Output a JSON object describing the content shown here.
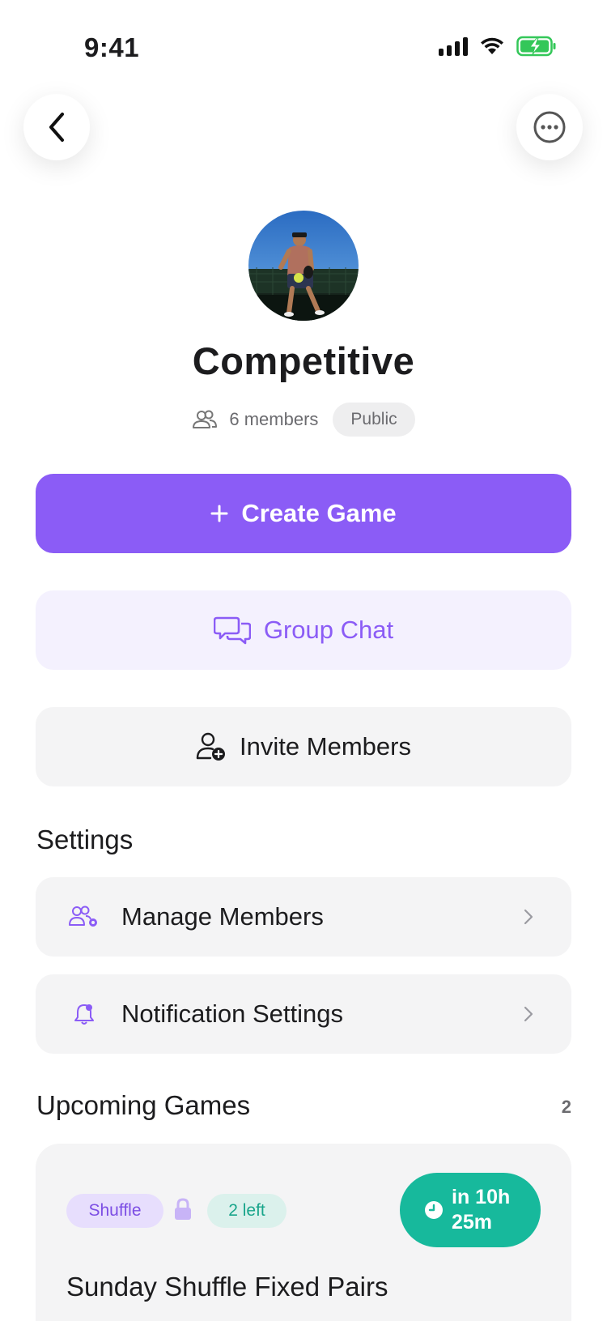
{
  "status_bar": {
    "time": "9:41"
  },
  "group": {
    "name": "Competitive",
    "members": "6 members",
    "visibility": "Public"
  },
  "actions": {
    "create_game": "Create Game",
    "group_chat": "Group Chat",
    "invite_members": "Invite Members"
  },
  "settings": {
    "title": "Settings",
    "items": [
      {
        "label": "Manage Members",
        "icon": "manage-members-icon"
      },
      {
        "label": "Notification Settings",
        "icon": "bell-icon"
      }
    ]
  },
  "upcoming": {
    "title": "Upcoming Games",
    "count": "2",
    "games": [
      {
        "type_tag": "Shuffle",
        "spots_tag": "2 left",
        "countdown": "in 10h 25m",
        "title": "Sunday Shuffle Fixed Pairs"
      }
    ]
  },
  "colors": {
    "primary": "#8b5cf6",
    "primary_soft": "#f4f1fe",
    "teal": "#17b99c",
    "surface": "#f4f4f5",
    "battery": "#34c759"
  }
}
